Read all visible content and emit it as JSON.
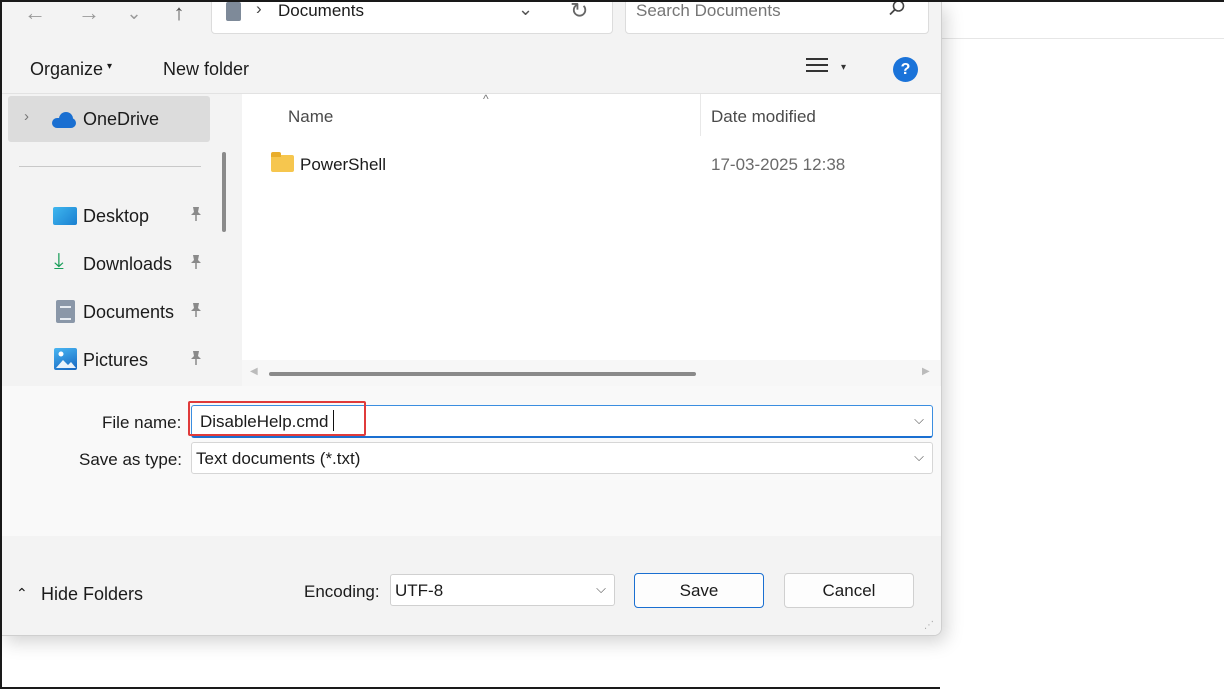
{
  "address_bar": {
    "back_glyph": "←",
    "forward_glyph": "→",
    "recent_glyph": "⌄",
    "up_glyph": "↑",
    "separator": "›",
    "path": "Documents",
    "dropdown_glyph": "⌄",
    "refresh_glyph": "↻"
  },
  "search": {
    "placeholder": "Search Documents",
    "icon": "search-icon"
  },
  "toolbar": {
    "organize_label": "Organize",
    "caret": "▾",
    "new_folder_label": "New folder",
    "help_label": "?"
  },
  "nav": {
    "onedrive_label": "OneDrive",
    "expander": "›",
    "pin_glyph": "📌",
    "items": [
      {
        "label": "Desktop",
        "icon": "desktop-icon"
      },
      {
        "label": "Downloads",
        "icon": "download-arrow-icon",
        "glyph": "⤓"
      },
      {
        "label": "Documents",
        "icon": "documents-icon"
      },
      {
        "label": "Pictures",
        "icon": "pictures-icon"
      }
    ]
  },
  "file_list": {
    "sort_glyph": "^",
    "columns": [
      "Name",
      "Date modified"
    ],
    "rows": [
      {
        "name": "PowerShell",
        "date_modified": "17-03-2025 12:38",
        "icon": "folder-icon"
      }
    ],
    "scroll_left": "◀",
    "scroll_right": "▶"
  },
  "form": {
    "file_name_label": "File name:",
    "file_name_value": "DisableHelp.cmd",
    "save_as_type_label": "Save as type:",
    "save_as_type_value": "Text documents (*.txt)",
    "dropdown_glyph": "⌵"
  },
  "footer": {
    "hide_folders_glyph": "⌃",
    "hide_folders_label": "Hide Folders",
    "encoding_label": "Encoding:",
    "encoding_value": "UTF-8",
    "save_label": "Save",
    "cancel_label": "Cancel",
    "grip_glyph": "⋰"
  },
  "colors": {
    "accent": "#1a6fd1",
    "highlight": "#e03b3b",
    "folder": "#f6c64e"
  }
}
